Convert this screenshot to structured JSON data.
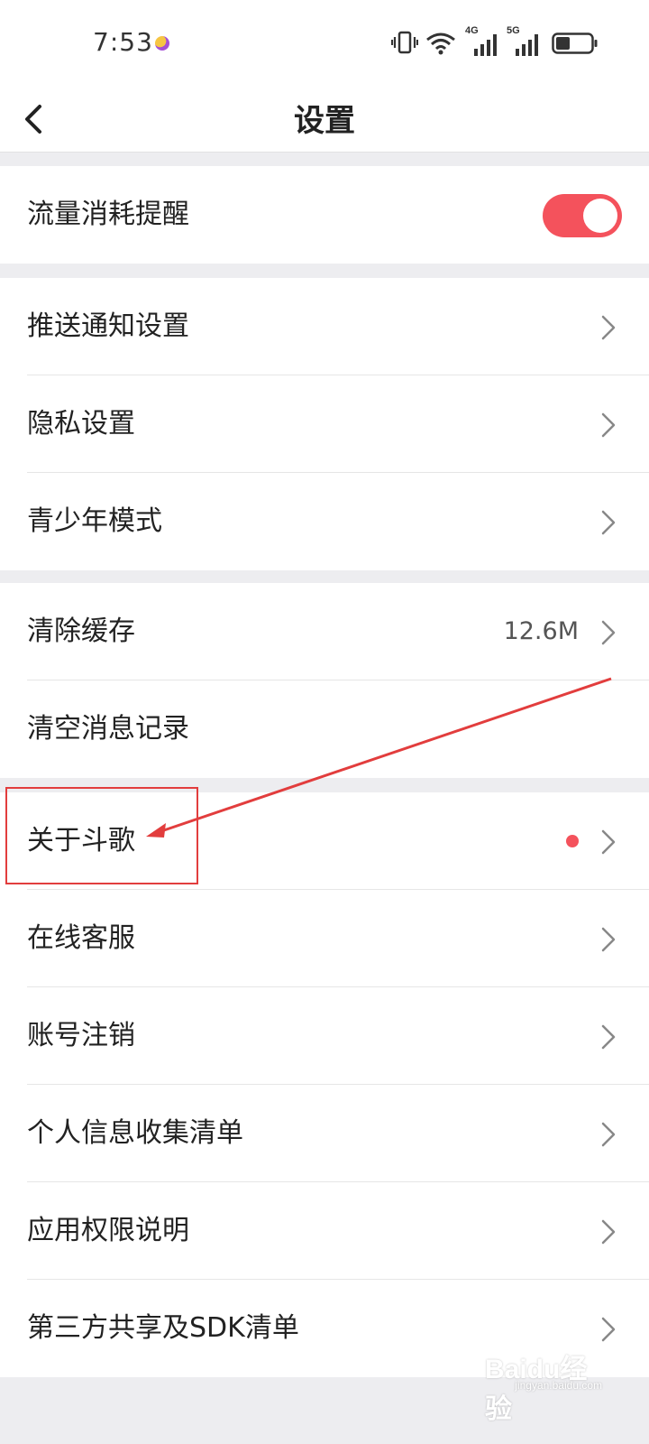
{
  "status_bar": {
    "time": "7:53",
    "signal_1_label": "4G",
    "signal_2_label": "5G",
    "icons": [
      "vibrate-icon",
      "wifi-icon",
      "signal-4g-icon",
      "signal-5g-icon",
      "battery-icon"
    ]
  },
  "header": {
    "title": "设置",
    "back_icon": "chevron-left-icon"
  },
  "sections": {
    "data_usage": {
      "label": "流量消耗提醒",
      "toggle_on": true
    },
    "notifications": {
      "items": [
        "推送通知设置",
        "隐私设置",
        "青少年模式"
      ]
    },
    "storage": {
      "clear_cache_label": "清除缓存",
      "clear_cache_value": "12.6M",
      "clear_messages_label": "清空消息记录"
    },
    "about": {
      "items": [
        "关于斗歌",
        "在线客服",
        "账号注销",
        "个人信息收集清单",
        "应用权限说明",
        "第三方共享及SDK清单"
      ]
    }
  },
  "watermark": {
    "main": "Baidu经验",
    "sub": "jingyan.baidu.com"
  },
  "colors": {
    "accent": "#f4525c",
    "background": "#ededf0",
    "annotation": "#e23d3d"
  }
}
